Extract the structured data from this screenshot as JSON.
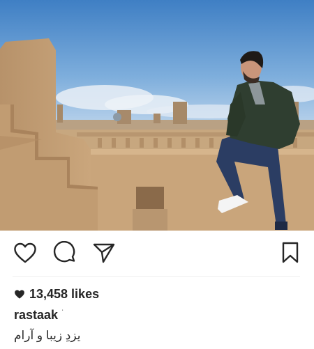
{
  "post": {
    "photo": {
      "description_icon": "photo-image"
    },
    "actions": {
      "like_icon": "heart-outline-icon",
      "comment_icon": "comment-bubble-icon",
      "share_icon": "paper-plane-icon",
      "save_icon": "bookmark-icon"
    },
    "likes_label": "13,458 likes",
    "username": "rastaak",
    "username_mark": "ˈ",
    "caption": "یزدِ زیبا و آرام"
  }
}
